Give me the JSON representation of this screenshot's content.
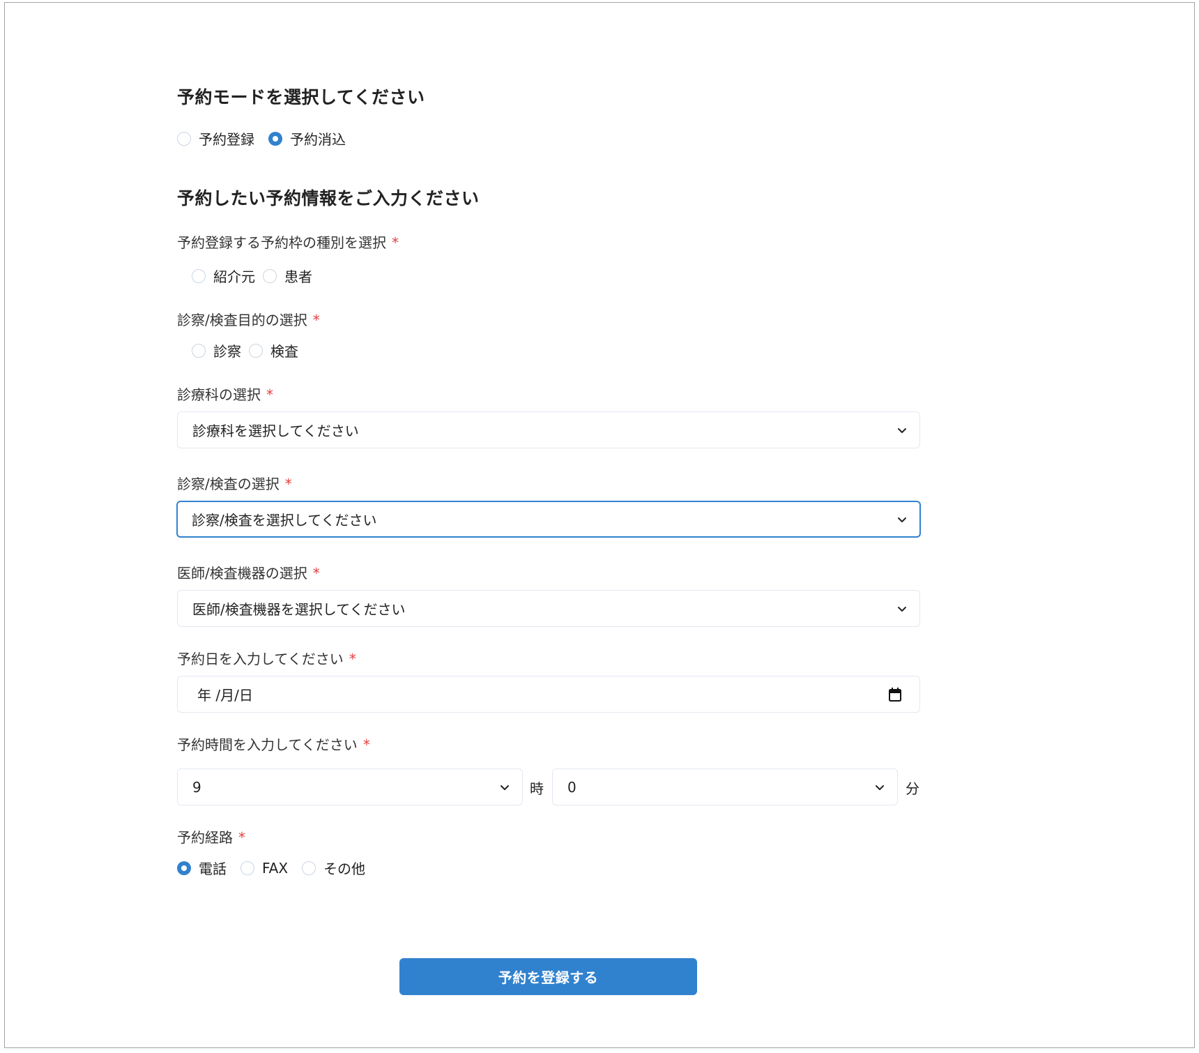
{
  "mode_section": {
    "title": "予約モードを選択してください",
    "options": [
      {
        "label": "予約登録",
        "checked": false
      },
      {
        "label": "予約消込",
        "checked": true
      }
    ]
  },
  "info_section": {
    "title": "予約したい予約情報をご入力ください"
  },
  "slot_type": {
    "label": "予約登録する予約枠の種別を選択",
    "required_mark": "*",
    "options": [
      {
        "label": "紹介元",
        "checked": false
      },
      {
        "label": "患者",
        "checked": false
      }
    ]
  },
  "purpose": {
    "label": "診察/検査目的の選択",
    "required_mark": "*",
    "options": [
      {
        "label": "診察",
        "checked": false
      },
      {
        "label": "検査",
        "checked": false
      }
    ]
  },
  "department": {
    "label": "診療科の選択",
    "required_mark": "*",
    "placeholder": "診療科を選択してください"
  },
  "exam": {
    "label": "診察/検査の選択",
    "required_mark": "*",
    "placeholder": "診察/検査を選択してください"
  },
  "doctor": {
    "label": "医師/検査機器の選択",
    "required_mark": "*",
    "placeholder": "医師/検査機器を選択してください"
  },
  "date": {
    "label": "予約日を入力してください",
    "required_mark": "*",
    "value": "年 /月/日",
    "icon": "calendar-icon"
  },
  "time": {
    "label": "予約時間を入力してください",
    "required_mark": "*",
    "hour_value": "9",
    "hour_unit": "時",
    "minute_value": "0",
    "minute_unit": "分"
  },
  "route": {
    "label": "予約経路",
    "required_mark": "*",
    "options": [
      {
        "label": "電話",
        "checked": true
      },
      {
        "label": "FAX",
        "checked": false
      },
      {
        "label": "その他",
        "checked": false
      }
    ]
  },
  "submit": {
    "label": "予約を登録する"
  },
  "colors": {
    "accent": "#3182ce",
    "required": "#e53e3e",
    "border": "#e2e8f0"
  }
}
